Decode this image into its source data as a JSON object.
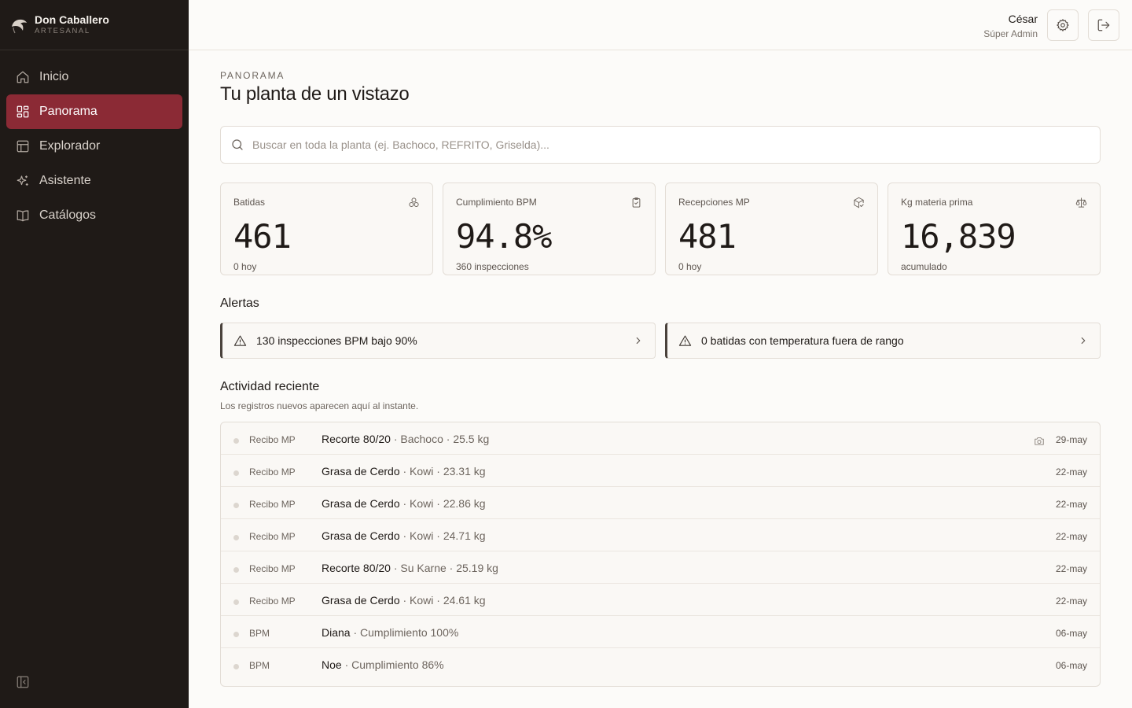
{
  "brand": {
    "name": "Don Caballero",
    "sub": "ARTESANAL"
  },
  "sidebar": {
    "items": [
      {
        "label": "Inicio",
        "icon": "home-icon",
        "active": false
      },
      {
        "label": "Panorama",
        "icon": "dashboard-icon",
        "active": true
      },
      {
        "label": "Explorador",
        "icon": "table-icon",
        "active": false
      },
      {
        "label": "Asistente",
        "icon": "sparkles-icon",
        "active": false
      },
      {
        "label": "Catálogos",
        "icon": "book-icon",
        "active": false
      }
    ],
    "collapse_icon": "sidebar-collapse-icon"
  },
  "topbar": {
    "user_name": "César",
    "user_role": "Súper Admin",
    "settings_icon": "gear-icon",
    "logout_icon": "logout-icon"
  },
  "page": {
    "eyebrow": "PANORAMA",
    "title": "Tu planta de un vistazo"
  },
  "search": {
    "placeholder": "Buscar en toda la planta (ej. Bachoco, REFRITO, Griselda)...",
    "value": ""
  },
  "stats": [
    {
      "label": "Batidas",
      "value": "461",
      "sub": "0 hoy",
      "icon": "cubes-icon"
    },
    {
      "label": "Cumplimiento BPM",
      "value": "94.8%",
      "sub": "360 inspecciones",
      "icon": "clipboard-check-icon"
    },
    {
      "label": "Recepciones MP",
      "value": "481",
      "sub": "0 hoy",
      "icon": "package-check-icon"
    },
    {
      "label": "Kg materia prima",
      "value": "16,839",
      "sub": "acumulado",
      "icon": "scale-icon"
    }
  ],
  "alerts": {
    "title": "Alertas",
    "items": [
      {
        "text": "130 inspecciones BPM bajo 90%"
      },
      {
        "text": "0 batidas con temperatura fuera de rango"
      }
    ]
  },
  "activity": {
    "title": "Actividad reciente",
    "subtitle": "Los registros nuevos aparecen aquí al instante.",
    "rows": [
      {
        "type": "Recibo MP",
        "main": "Recorte 80/20",
        "detail": " · Bachoco · 25.5 kg",
        "date": "29-may",
        "has_photo": true
      },
      {
        "type": "Recibo MP",
        "main": "Grasa de Cerdo",
        "detail": " · Kowi · 23.31 kg",
        "date": "22-may",
        "has_photo": false
      },
      {
        "type": "Recibo MP",
        "main": "Grasa de Cerdo",
        "detail": " · Kowi · 22.86 kg",
        "date": "22-may",
        "has_photo": false
      },
      {
        "type": "Recibo MP",
        "main": "Grasa de Cerdo",
        "detail": " · Kowi · 24.71 kg",
        "date": "22-may",
        "has_photo": false
      },
      {
        "type": "Recibo MP",
        "main": "Recorte 80/20",
        "detail": " · Su Karne · 25.19 kg",
        "date": "22-may",
        "has_photo": false
      },
      {
        "type": "Recibo MP",
        "main": "Grasa de Cerdo",
        "detail": " · Kowi · 24.61 kg",
        "date": "22-may",
        "has_photo": false
      },
      {
        "type": "BPM",
        "main": "Diana",
        "detail": " · Cumplimiento 100%",
        "date": "06-may",
        "has_photo": false
      },
      {
        "type": "BPM",
        "main": "Noe",
        "detail": " · Cumplimiento 86%",
        "date": "06-may",
        "has_photo": false
      }
    ]
  },
  "colors": {
    "sidebar_bg": "#1f1a17",
    "accent": "#8b2a35",
    "page_bg": "#fcfbf9"
  }
}
